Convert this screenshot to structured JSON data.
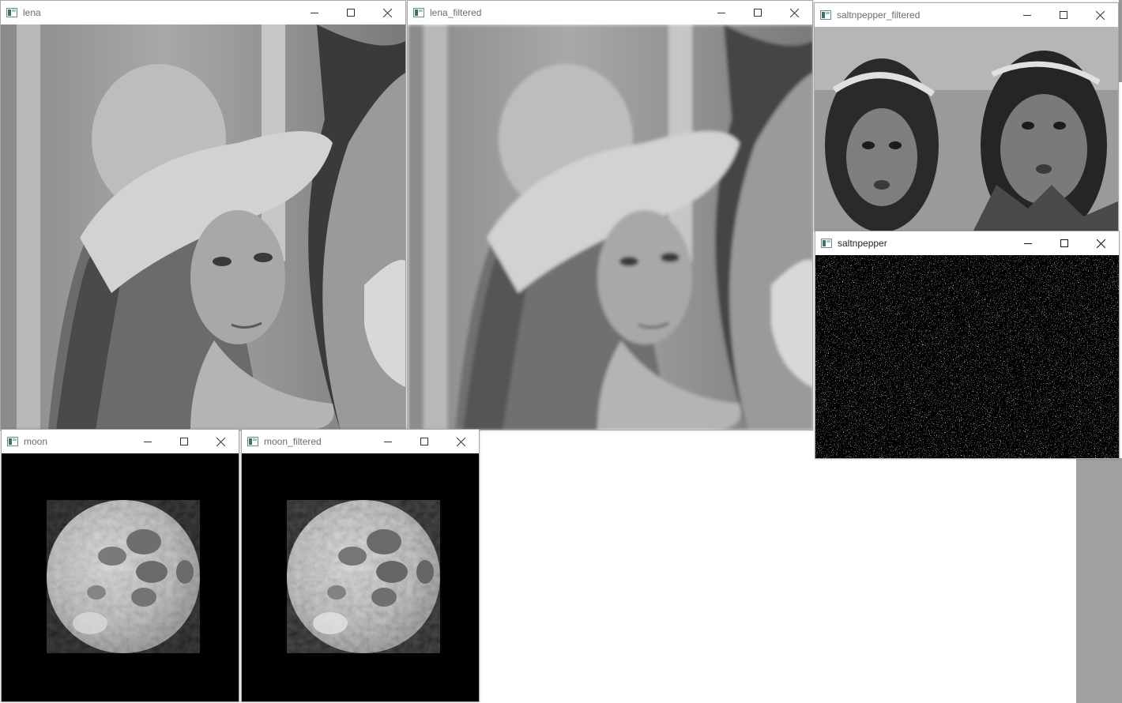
{
  "windows": {
    "lena": {
      "title": "lena"
    },
    "lena_filtered": {
      "title": "lena_filtered"
    },
    "saltnpepper_filtered": {
      "title": "saltnpepper_filtered"
    },
    "saltnpepper": {
      "title": "saltnpepper"
    },
    "moon": {
      "title": "moon"
    },
    "moon_filtered": {
      "title": "moon_filtered"
    }
  },
  "icons": {
    "app": "opencv-window-icon",
    "minimize": "minimize-icon",
    "maximize": "maximize-icon",
    "close": "close-icon"
  },
  "colors": {
    "desktop": "#a0a0a0",
    "titlebar": "#ffffff",
    "image_background_moon": "#000000"
  }
}
